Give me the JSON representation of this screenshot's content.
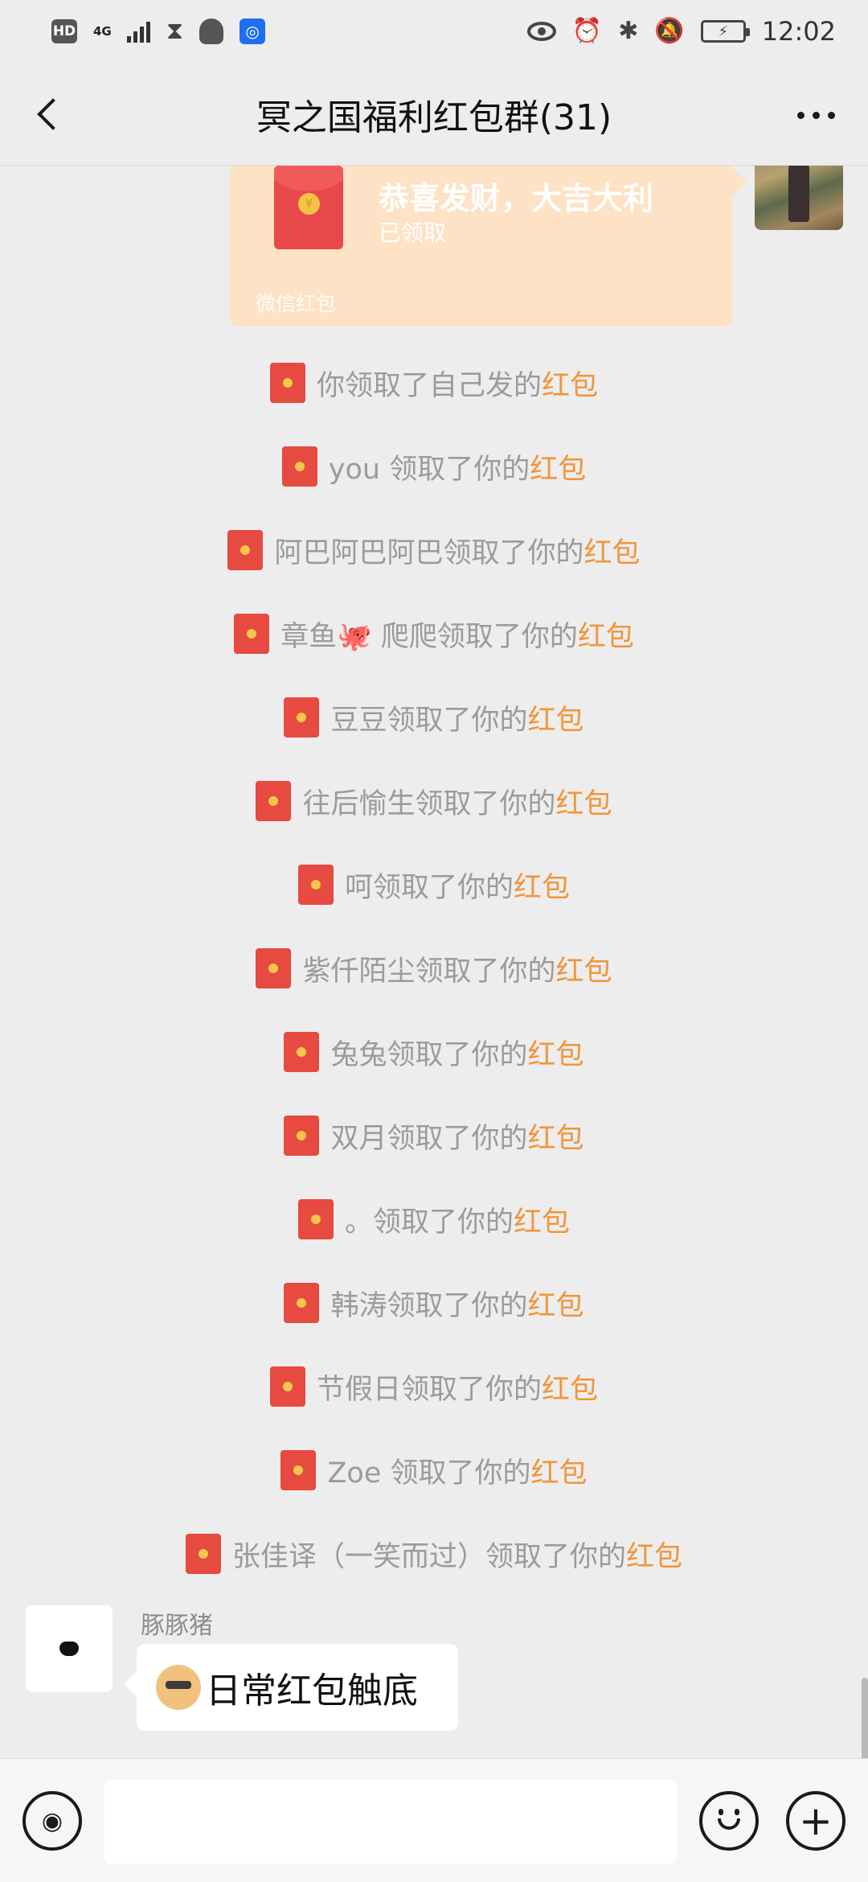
{
  "status_bar": {
    "hd": "HD",
    "network": "4G",
    "time": "12:02",
    "icons": [
      "hd-icon",
      "signal-icon",
      "hourglass-icon",
      "qq-icon",
      "bulb-icon",
      "eye-icon",
      "alarm-icon",
      "bluetooth-icon",
      "mute-icon",
      "battery-charging-icon"
    ]
  },
  "header": {
    "title": "冥之国福利红包群(31)"
  },
  "red_packet": {
    "title": "恭喜发财，大吉大利",
    "status": "已领取",
    "footer": "微信红包",
    "coin": "¥"
  },
  "notices": [
    {
      "prefix": "你领取了自己发的",
      "link": "红包"
    },
    {
      "prefix": "you 领取了你的",
      "link": "红包"
    },
    {
      "prefix": "阿巴阿巴阿巴领取了你的",
      "link": "红包"
    },
    {
      "prefix": "章鱼🐙 爬爬领取了你的",
      "link": "红包"
    },
    {
      "prefix": "豆豆领取了你的",
      "link": "红包"
    },
    {
      "prefix": "往后愉生领取了你的",
      "link": "红包"
    },
    {
      "prefix": "呵领取了你的",
      "link": "红包"
    },
    {
      "prefix": "紫仟陌尘领取了你的",
      "link": "红包"
    },
    {
      "prefix": "兔兔领取了你的",
      "link": "红包"
    },
    {
      "prefix": "双月领取了你的",
      "link": "红包"
    },
    {
      "prefix": "。领取了你的",
      "link": "红包"
    },
    {
      "prefix": "韩涛领取了你的",
      "link": "红包"
    },
    {
      "prefix": "节假日领取了你的",
      "link": "红包"
    },
    {
      "prefix": "Zoe 领取了你的",
      "link": "红包"
    },
    {
      "prefix": "张佳译（一笑而过）领取了你的",
      "link": "红包"
    }
  ],
  "last_message": {
    "sender": "豚豚猪",
    "text": "日常红包触底"
  },
  "input_bar": {
    "value": ""
  }
}
